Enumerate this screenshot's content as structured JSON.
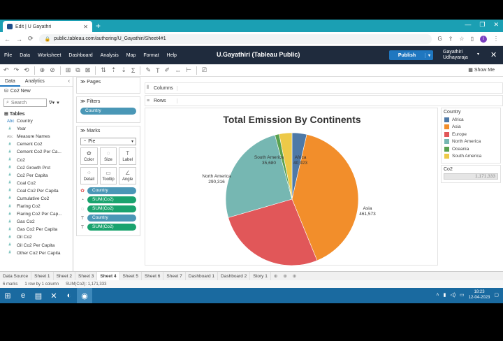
{
  "browser": {
    "tab_title": "Edit | U Gayathri",
    "new_tab": "+",
    "url": "public.tableau.com/authoring/U_Gayathiri/Sheet4#1",
    "profile_initial": "I"
  },
  "tableau": {
    "menus": [
      "File",
      "Data",
      "Worksheet",
      "Dashboard",
      "Analysis",
      "Map",
      "Format",
      "Help"
    ],
    "workbook_title": "U.Gayathiri (Tableau Public)",
    "publish_label": "Publish",
    "user_line1": "Gayathiri",
    "user_line2": "Udhayaraja",
    "show_me": "Show Me"
  },
  "data_pane": {
    "tab_data": "Data",
    "tab_analytics": "Analytics",
    "datasource": "Co2 New",
    "search_placeholder": "Search",
    "tables_heading": "Tables",
    "fields": [
      {
        "icon": "Abc",
        "name": "Country",
        "kind": "dim"
      },
      {
        "icon": "#",
        "name": "Year",
        "kind": "msr"
      },
      {
        "icon": "Abc",
        "name": "Measure Names",
        "kind": "mn"
      },
      {
        "icon": "#",
        "name": "Cement Co2",
        "kind": "msr"
      },
      {
        "icon": "#",
        "name": "Cement Co2 Per Ca...",
        "kind": "msr"
      },
      {
        "icon": "#",
        "name": "Co2",
        "kind": "msr"
      },
      {
        "icon": "#",
        "name": "Co2 Growth Prct",
        "kind": "msr"
      },
      {
        "icon": "#",
        "name": "Co2 Per Capita",
        "kind": "msr"
      },
      {
        "icon": "#",
        "name": "Coal Co2",
        "kind": "msr"
      },
      {
        "icon": "#",
        "name": "Coal Co2 Per Capita",
        "kind": "msr"
      },
      {
        "icon": "#",
        "name": "Cumulative Co2",
        "kind": "msr"
      },
      {
        "icon": "#",
        "name": "Flaring Co2",
        "kind": "msr"
      },
      {
        "icon": "#",
        "name": "Flaring Co2 Per Cap...",
        "kind": "msr"
      },
      {
        "icon": "#",
        "name": "Gas Co2",
        "kind": "msr"
      },
      {
        "icon": "#",
        "name": "Gas Co2 Per Capita",
        "kind": "msr"
      },
      {
        "icon": "#",
        "name": "Oil Co2",
        "kind": "msr"
      },
      {
        "icon": "#",
        "name": "Oil Co2 Per Capita",
        "kind": "msr"
      },
      {
        "icon": "#",
        "name": "Other Co2 Per Capita",
        "kind": "msr"
      }
    ]
  },
  "shelves": {
    "pages": "Pages",
    "filters": "Filters",
    "filter_pill": "Country",
    "marks": "Marks",
    "mark_type": "Pie",
    "mark_buttons": [
      "Color",
      "Size",
      "Label",
      "Detail",
      "Tooltip",
      "Angle"
    ],
    "mark_pills": [
      {
        "label": "Country",
        "kind": "dim"
      },
      {
        "label": "SUM(Co2)",
        "kind": "msr"
      },
      {
        "label": "SUM(Co2)",
        "kind": "msr"
      },
      {
        "label": "Country",
        "kind": "dim"
      },
      {
        "label": "SUM(Co2)",
        "kind": "msr"
      }
    ],
    "columns": "Columns",
    "rows": "Rows"
  },
  "chart_data": {
    "type": "pie",
    "title": "Total Emission By Continents",
    "categories": [
      "Africa",
      "Asia",
      "Europe",
      "North America",
      "Oceania",
      "South America"
    ],
    "values": [
      40923,
      461573,
      306165,
      290316,
      12000,
      35680
    ],
    "colors": [
      "#4e79a7",
      "#f28e2b",
      "#e15759",
      "#76b7b2",
      "#59a14f",
      "#edc948"
    ],
    "data_labels": [
      {
        "name": "Africa",
        "value": "40,923"
      },
      {
        "name": "Asia",
        "value": "461,573"
      },
      {
        "name": "Europe",
        "value": "306,165"
      },
      {
        "name": "North America",
        "value": "290,316"
      },
      {
        "name": "South America",
        "value": "35,680"
      }
    ],
    "legend_title": "Country",
    "legend_placement": "right",
    "size_legend_title": "Co2",
    "size_legend_value": "1,171,333"
  },
  "sheet_tabs": [
    "Data Source",
    "Sheet 1",
    "Sheet 2",
    "Sheet 3",
    "Sheet 4",
    "Sheet 5",
    "Sheet 6",
    "Sheet 7",
    "Dashboard 1",
    "Dashboard 2",
    "Story 1"
  ],
  "active_sheet": "Sheet 4",
  "status": {
    "marks": "6 marks",
    "rows": "1 row by 1 column",
    "sum": "SUM(Co2): 1,171,333"
  },
  "taskbar": {
    "time": "18:23",
    "date": "12-04-2023"
  }
}
